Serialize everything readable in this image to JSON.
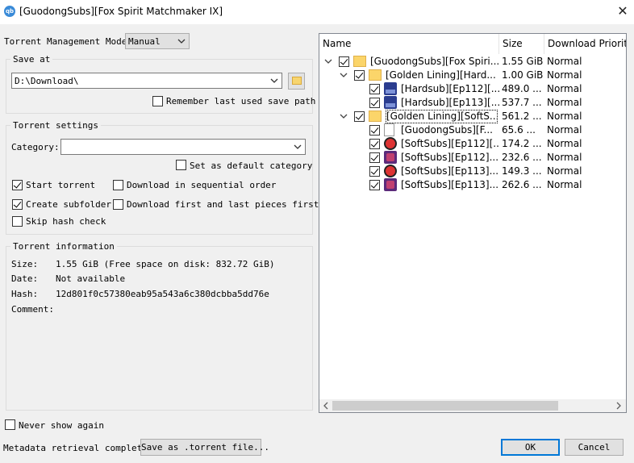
{
  "window": {
    "title": "[GuodongSubs][Fox Spirit Matchmaker IX]",
    "app_icon": "qb"
  },
  "management": {
    "label": "Torrent Management Mode:",
    "value": "Manual"
  },
  "save_at": {
    "title": "Save at",
    "path": "D:\\Download\\",
    "remember_label": "Remember last used save path",
    "remember_checked": false
  },
  "settings": {
    "title": "Torrent settings",
    "category_label": "Category:",
    "category_value": "",
    "default_category_label": "Set as default category",
    "start_torrent_label": "Start torrent",
    "sequential_label": "Download in sequential order",
    "subfolder_label": "Create subfolder",
    "first_last_label": "Download first and last pieces first",
    "skip_hash_label": "Skip hash check"
  },
  "info": {
    "title": "Torrent information",
    "size_label": "Size:",
    "size_value": "1.55 GiB (Free space on disk: 832.72 GiB)",
    "date_label": "Date:",
    "date_value": "Not available",
    "hash_label": "Hash:",
    "hash_value": "12d801f0c57380eab95a543a6c380dcbba5dd76e",
    "comment_label": "Comment:"
  },
  "tree": {
    "columns": [
      "Name",
      "Size",
      "Download Priorit"
    ],
    "rows": [
      {
        "name": "[GuodongSubs][Fox Spiri...",
        "size": "1.55 GiB",
        "priority": "Normal",
        "level": 0,
        "icon": "folder-icon",
        "expandable": true
      },
      {
        "name": "[Golden Lining][Hard...",
        "size": "1.00 GiB",
        "priority": "Normal",
        "level": 1,
        "icon": "folder-icon",
        "expandable": true
      },
      {
        "name": "[Hardsub][Ep112][...",
        "size": "489.0 ...",
        "priority": "Normal",
        "level": 2,
        "icon": "mkv-file-icon",
        "expandable": false
      },
      {
        "name": "[Hardsub][Ep113][...",
        "size": "537.7 ...",
        "priority": "Normal",
        "level": 2,
        "icon": "mkv-file-icon",
        "expandable": false
      },
      {
        "name": "[Golden Lining][SoftS...",
        "size": "561.2 ...",
        "priority": "Normal",
        "level": 1,
        "icon": "folder-icon",
        "expandable": true
      },
      {
        "name": "[GuodongSubs][F...",
        "size": "65.6 ...",
        "priority": "Normal",
        "level": 2,
        "icon": "document-file-icon",
        "expandable": false
      },
      {
        "name": "[SoftSubs][Ep112][...",
        "size": "174.2 ...",
        "priority": "Normal",
        "level": 2,
        "icon": "round-media-icon",
        "expandable": false
      },
      {
        "name": "[SoftSubs][Ep112]...",
        "size": "232.6 ...",
        "priority": "Normal",
        "level": 2,
        "icon": "mp4-file-icon",
        "expandable": false
      },
      {
        "name": "[SoftSubs][Ep113]...",
        "size": "149.3 ...",
        "priority": "Normal",
        "level": 2,
        "icon": "round-media-icon",
        "expandable": false
      },
      {
        "name": "[SoftSubs][Ep113]...",
        "size": "262.6 ...",
        "priority": "Normal",
        "level": 2,
        "icon": "mp4-file-icon",
        "expandable": false
      }
    ]
  },
  "footer": {
    "never_show_label": "Never show again",
    "status": "Metadata retrieval complete",
    "save_torrent_label": "Save as .torrent file...",
    "ok_label": "OK",
    "cancel_label": "Cancel"
  },
  "colors": {
    "accent": "#0078d7",
    "folder": "#fbd56a"
  }
}
